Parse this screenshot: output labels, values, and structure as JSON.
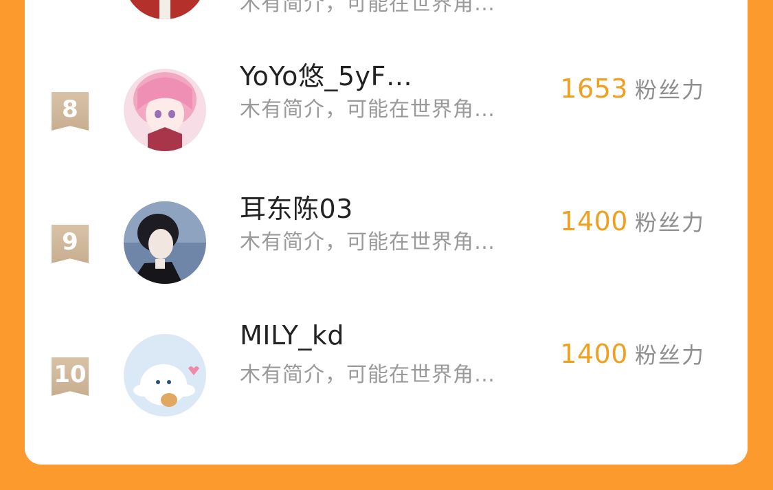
{
  "rows": [
    {
      "bio": "木有简介，可能在世界角…"
    },
    {
      "rank": "8",
      "name": "YoYo悠_5yF…",
      "bio": "木有简介，可能在世界角…",
      "score": "1653",
      "unit": "粉丝力"
    },
    {
      "rank": "9",
      "name": "耳东陈03",
      "bio": "木有简介，可能在世界角…",
      "score": "1400",
      "unit": "粉丝力"
    },
    {
      "rank": "10",
      "name": "MILY_kd",
      "bio": "木有简介，可能在世界角…",
      "score": "1400",
      "unit": "粉丝力"
    }
  ],
  "colors": {
    "background": "#fc9a2e",
    "card": "#ffffff",
    "score": "#f0a020",
    "rank_badge": "#cdb496"
  },
  "icons": [
    "avatar-image",
    "rank-ribbon-badge"
  ]
}
